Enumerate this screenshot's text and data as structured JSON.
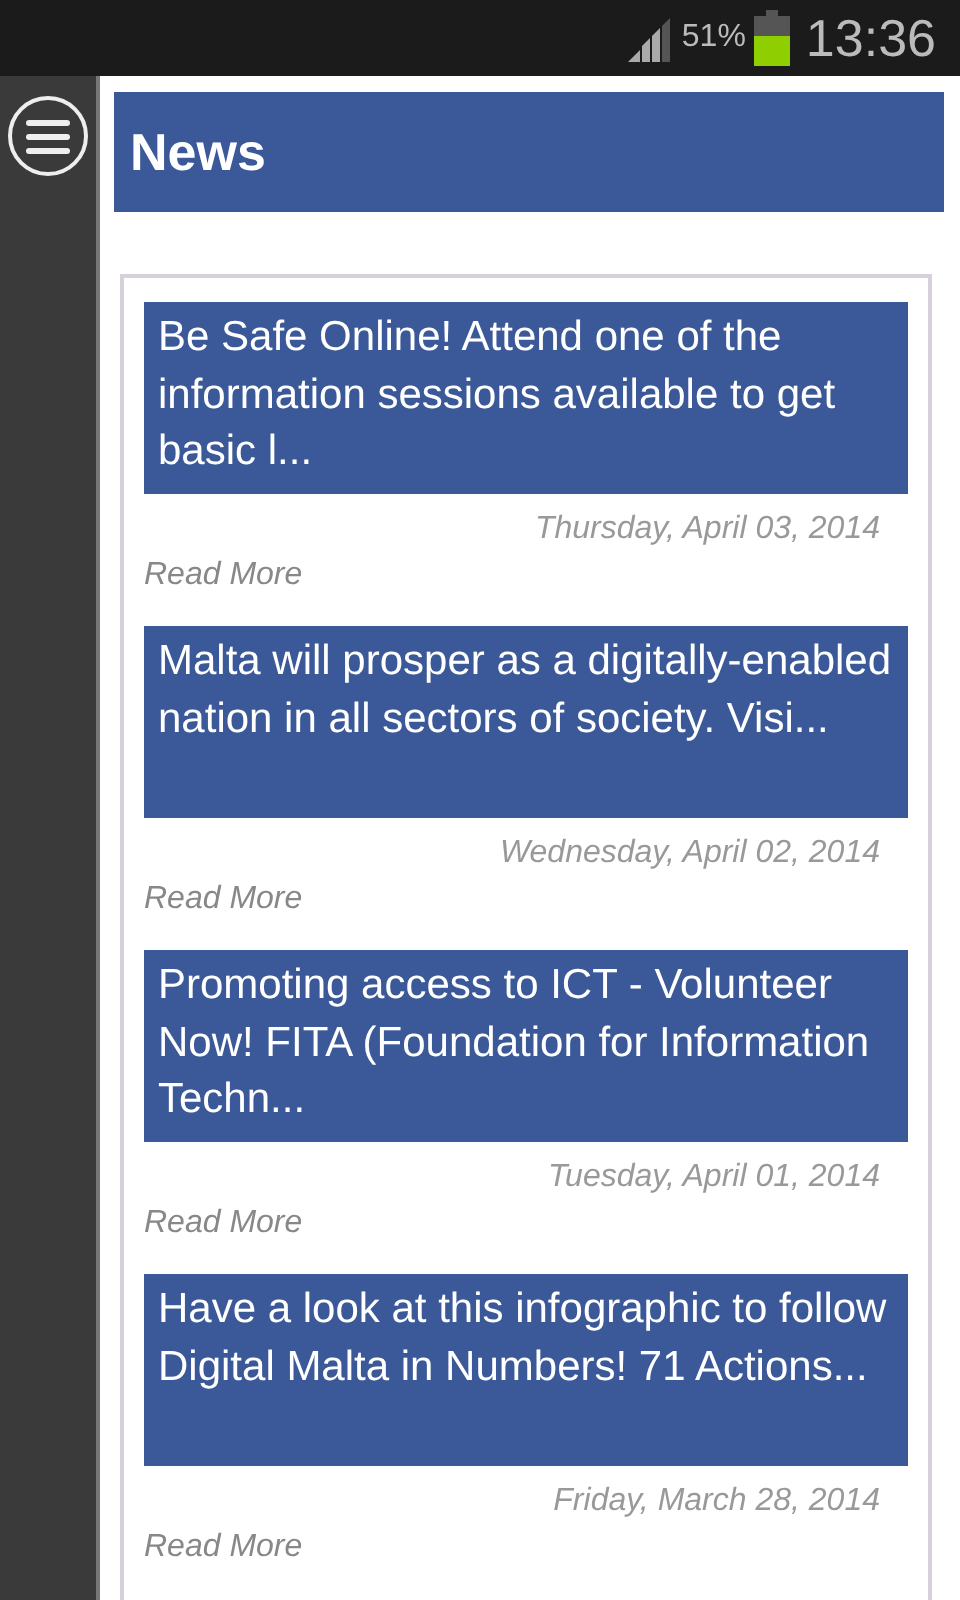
{
  "status_bar": {
    "battery": "51%",
    "time": "13:36"
  },
  "header": {
    "title": "News"
  },
  "news": [
    {
      "title": "Be Safe Online! Attend one of the information sessions available to get basic l...",
      "date": "Thursday, April 03, 2014",
      "link": "Read More"
    },
    {
      "title": "Malta will prosper as a digitally-enabled nation in all sectors of society. Visi...",
      "date": "Wednesday, April 02, 2014",
      "link": "Read More"
    },
    {
      "title": "Promoting access to ICT - Volunteer Now! FITA (Foundation for Information Techn...",
      "date": "Tuesday, April 01, 2014",
      "link": "Read More"
    },
    {
      "title": "Have a look at this infographic to follow Digital Malta in Numbers! 71 Actions...",
      "date": "Friday, March 28, 2014",
      "link": "Read More"
    }
  ]
}
